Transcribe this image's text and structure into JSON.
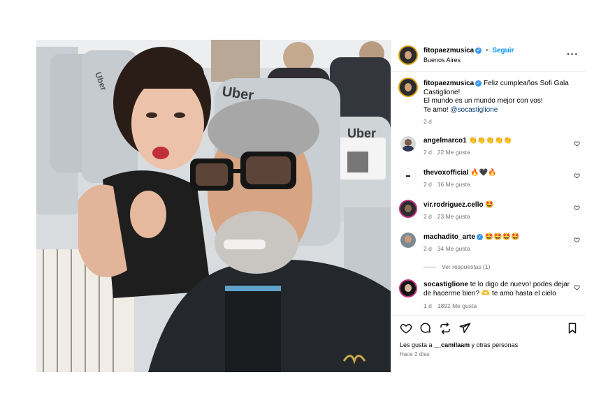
{
  "header": {
    "username": "fitopaezmusica",
    "dot": "•",
    "follow_label": "Seguir",
    "location": "Buenos Aires",
    "more_icon": "more-horizontal-icon"
  },
  "caption": {
    "username": "fitopaezmusica",
    "line1": "Feliz cumpleaños Sofi Gala",
    "line2": "Castiglione!",
    "line3": "El mundo es un mundo mejor con vos!",
    "line4_prefix": "Te amo!",
    "mention": "@socastiglione",
    "time": "2 d"
  },
  "comments": [
    {
      "username": "angelmarco1",
      "text": "👏👏👏👏👏",
      "time": "2 d",
      "likes": "22 Me gusta"
    },
    {
      "username": "thevoxofficial",
      "text": "🔥🖤🔥",
      "time": "2 d",
      "likes": "16 Me gusta"
    },
    {
      "username": "vir.rodriguez.cello",
      "text": "🤩",
      "time": "2 d",
      "likes": "23 Me gusta"
    },
    {
      "username": "machadito_arte",
      "text": "🤩🤩🤩🤩",
      "time": "2 d",
      "likes": "34 Me gusta"
    }
  ],
  "replies_toggle": "Ver respuestas (1)",
  "reply": {
    "username": "socastiglione",
    "line1": "te lo digo de nuevo! podes dejar",
    "line2": "de hacerme bien? 🫶 te amo hasta el cielo",
    "time": "1 d",
    "likes": "1892 Me gusta"
  },
  "likes_summary": {
    "prefix": "Les gusta a",
    "user": "__camilaam",
    "suffix": "y otras personas"
  },
  "posted": "Hace 2 días",
  "photo_text": {
    "seat_brand_1": "Uber",
    "seat_brand_2": "Uber",
    "seat_brand_3": "Uber"
  },
  "colors": {
    "accent_blue": "#0095f6",
    "verified_blue": "#3897f0",
    "meta_gray": "#737373"
  }
}
